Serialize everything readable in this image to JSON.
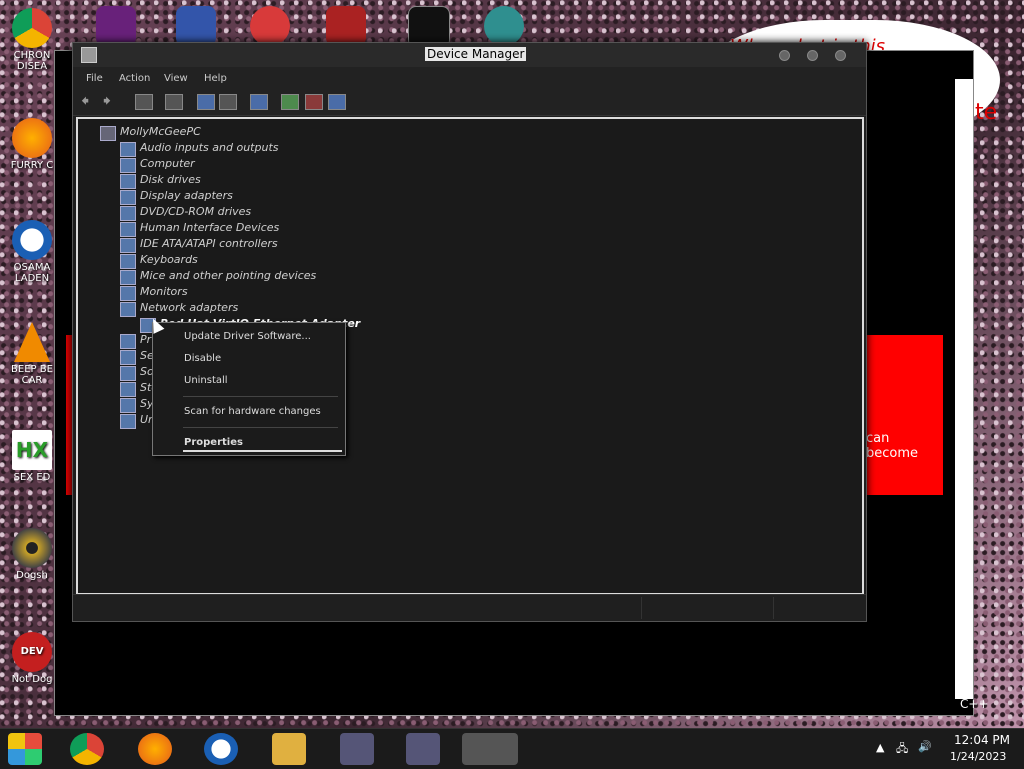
{
  "desktop": {
    "icons": [
      {
        "label": "CHRON DISEA",
        "icon": "chrome-icon"
      },
      {
        "label": "FURRY C",
        "icon": "firefox-icon"
      },
      {
        "label": "OSAMA LADEN",
        "icon": "obama-logo-icon"
      },
      {
        "label": "BEEP BE CAR",
        "icon": "vlc-cone-icon"
      },
      {
        "label": "SEX ED",
        "icon": "hex-icon"
      },
      {
        "label": "Dogsh",
        "icon": "disc-icon"
      },
      {
        "label": "Not Dog",
        "icon": "devcpp-icon"
      }
    ],
    "background_texts": {
      "red_panel": "can become",
      "speech_bubble": "te",
      "speech_top": "Wh... what is this",
      "bottom_right": "n C++"
    }
  },
  "device_manager": {
    "title": "Device Manager",
    "menu": [
      "File",
      "Action",
      "View",
      "Help"
    ],
    "tree": {
      "root": "MollyMcGeePC",
      "categories": [
        "Audio inputs and outputs",
        "Computer",
        "Disk drives",
        "Display adapters",
        "DVD/CD-ROM drives",
        "Human Interface Devices",
        "IDE ATA/ATAPI controllers",
        "Keyboards",
        "Mice and other pointing devices",
        "Monitors",
        "Network adapters"
      ],
      "network_child": "Red Hat VirtIO Ethernet Adapter",
      "partial_after": [
        "Pr",
        "Se",
        "So",
        "Sto",
        "Sy",
        "Un"
      ]
    }
  },
  "context_menu": {
    "items": [
      "Update Driver Software...",
      "Disable",
      "Uninstall",
      "Scan for hardware changes",
      "Properties"
    ]
  },
  "taskbar": {
    "time": "12:04 PM",
    "date": "1/24/2023"
  },
  "colors": {
    "window_bg": "#1e1e1e",
    "accent_red": "#ff0000",
    "taskbar": "#1b1b1b"
  }
}
